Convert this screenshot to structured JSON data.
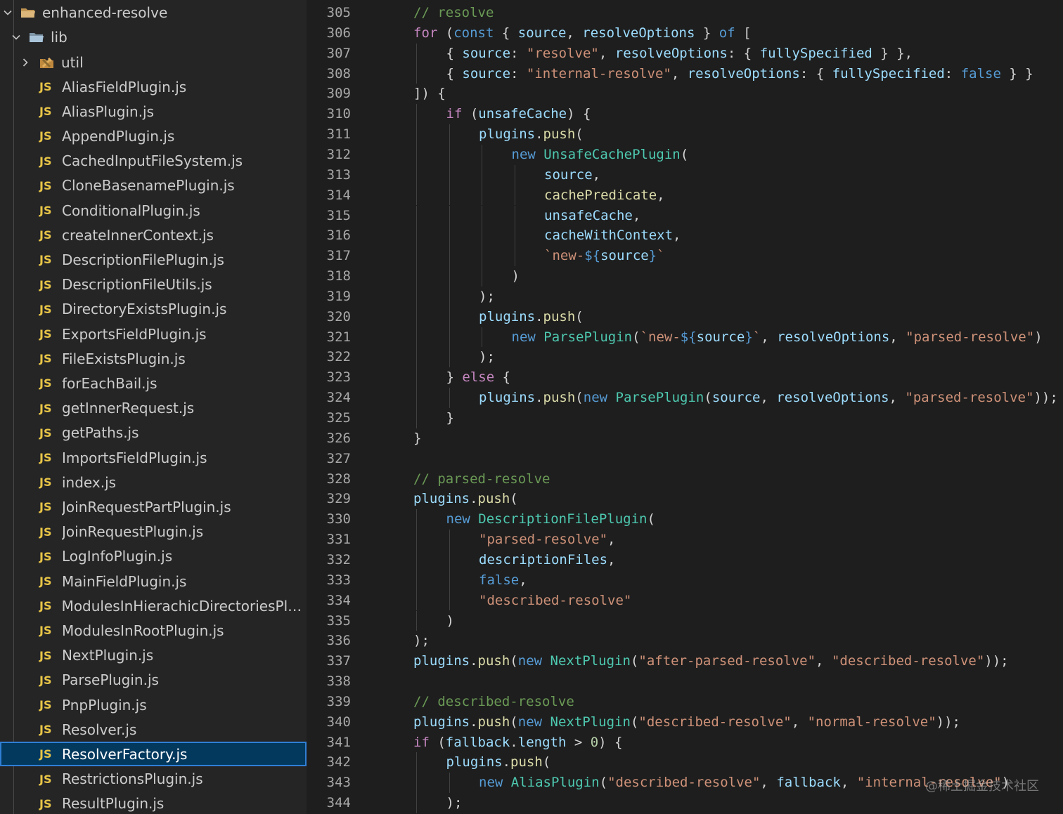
{
  "explorer": {
    "root": {
      "label": "enhanced-resolve",
      "icon": "folder-open-icon"
    },
    "lib": {
      "label": "lib",
      "icon": "folder-open-icon"
    },
    "util": {
      "label": "util",
      "icon": "tools-folder-icon"
    },
    "files": [
      "AliasFieldPlugin.js",
      "AliasPlugin.js",
      "AppendPlugin.js",
      "CachedInputFileSystem.js",
      "CloneBasenamePlugin.js",
      "ConditionalPlugin.js",
      "createInnerContext.js",
      "DescriptionFilePlugin.js",
      "DescriptionFileUtils.js",
      "DirectoryExistsPlugin.js",
      "ExportsFieldPlugin.js",
      "FileExistsPlugin.js",
      "forEachBail.js",
      "getInnerRequest.js",
      "getPaths.js",
      "ImportsFieldPlugin.js",
      "index.js",
      "JoinRequestPartPlugin.js",
      "JoinRequestPlugin.js",
      "LogInfoPlugin.js",
      "MainFieldPlugin.js",
      "ModulesInHierachicDirectoriesPlu...",
      "ModulesInRootPlugin.js",
      "NextPlugin.js",
      "ParsePlugin.js",
      "PnpPlugin.js",
      "Resolver.js",
      "ResolverFactory.js",
      "RestrictionsPlugin.js",
      "ResultPlugin.js"
    ],
    "file_icon_label": "JS",
    "selected_file": "ResolverFactory.js"
  },
  "editor": {
    "lines": [
      {
        "n": "305",
        "i": 0,
        "t": [
          [
            "cm",
            "// resolve"
          ]
        ]
      },
      {
        "n": "306",
        "i": 0,
        "t": [
          [
            "kwc",
            "for"
          ],
          [
            "pun",
            " ("
          ],
          [
            "kw",
            "const"
          ],
          [
            "pun",
            " { "
          ],
          [
            "var",
            "source"
          ],
          [
            "pun",
            ", "
          ],
          [
            "var",
            "resolveOptions"
          ],
          [
            "pun",
            " } "
          ],
          [
            "kw",
            "of"
          ],
          [
            "pun",
            " ["
          ]
        ]
      },
      {
        "n": "307",
        "i": 1,
        "t": [
          [
            "pun",
            "{ "
          ],
          [
            "var",
            "source"
          ],
          [
            "pun",
            ": "
          ],
          [
            "str",
            "\"resolve\""
          ],
          [
            "pun",
            ", "
          ],
          [
            "var",
            "resolveOptions"
          ],
          [
            "pun",
            ": { "
          ],
          [
            "var",
            "fullySpecified"
          ],
          [
            "pun",
            " } },"
          ]
        ]
      },
      {
        "n": "308",
        "i": 1,
        "t": [
          [
            "pun",
            "{ "
          ],
          [
            "var",
            "source"
          ],
          [
            "pun",
            ": "
          ],
          [
            "str",
            "\"internal-resolve\""
          ],
          [
            "pun",
            ", "
          ],
          [
            "var",
            "resolveOptions"
          ],
          [
            "pun",
            ": { "
          ],
          [
            "var",
            "fullySpecified"
          ],
          [
            "pun",
            ": "
          ],
          [
            "kw",
            "false"
          ],
          [
            "pun",
            " } }"
          ]
        ]
      },
      {
        "n": "309",
        "i": 0,
        "t": [
          [
            "pun",
            "]) {"
          ]
        ]
      },
      {
        "n": "310",
        "i": 1,
        "t": [
          [
            "kwc",
            "if"
          ],
          [
            "pun",
            " ("
          ],
          [
            "var",
            "unsafeCache"
          ],
          [
            "pun",
            ") {"
          ]
        ]
      },
      {
        "n": "311",
        "i": 2,
        "t": [
          [
            "var",
            "plugins"
          ],
          [
            "pun",
            "."
          ],
          [
            "fn",
            "push"
          ],
          [
            "pun",
            "("
          ]
        ]
      },
      {
        "n": "312",
        "i": 3,
        "t": [
          [
            "kw",
            "new"
          ],
          [
            "pun",
            " "
          ],
          [
            "cls",
            "UnsafeCachePlugin"
          ],
          [
            "pun",
            "("
          ]
        ]
      },
      {
        "n": "313",
        "i": 4,
        "t": [
          [
            "var",
            "source"
          ],
          [
            "pun",
            ","
          ]
        ]
      },
      {
        "n": "314",
        "i": 4,
        "t": [
          [
            "fn",
            "cachePredicate"
          ],
          [
            "pun",
            ","
          ]
        ]
      },
      {
        "n": "315",
        "i": 4,
        "t": [
          [
            "var",
            "unsafeCache"
          ],
          [
            "pun",
            ","
          ]
        ]
      },
      {
        "n": "316",
        "i": 4,
        "t": [
          [
            "var",
            "cacheWithContext"
          ],
          [
            "pun",
            ","
          ]
        ]
      },
      {
        "n": "317",
        "i": 4,
        "t": [
          [
            "str",
            "`new-"
          ],
          [
            "tpl",
            "${"
          ],
          [
            "var",
            "source"
          ],
          [
            "tpl",
            "}"
          ],
          [
            "str",
            "`"
          ]
        ]
      },
      {
        "n": "318",
        "i": 3,
        "t": [
          [
            "pun",
            ")"
          ]
        ]
      },
      {
        "n": "319",
        "i": 2,
        "t": [
          [
            "pun",
            ");"
          ]
        ]
      },
      {
        "n": "320",
        "i": 2,
        "t": [
          [
            "var",
            "plugins"
          ],
          [
            "pun",
            "."
          ],
          [
            "fn",
            "push"
          ],
          [
            "pun",
            "("
          ]
        ]
      },
      {
        "n": "321",
        "i": 3,
        "t": [
          [
            "kw",
            "new"
          ],
          [
            "pun",
            " "
          ],
          [
            "cls",
            "ParsePlugin"
          ],
          [
            "pun",
            "("
          ],
          [
            "str",
            "`new-"
          ],
          [
            "tpl",
            "${"
          ],
          [
            "var",
            "source"
          ],
          [
            "tpl",
            "}"
          ],
          [
            "str",
            "`"
          ],
          [
            "pun",
            ", "
          ],
          [
            "var",
            "resolveOptions"
          ],
          [
            "pun",
            ", "
          ],
          [
            "str",
            "\"parsed-resolve\""
          ],
          [
            "pun",
            ")"
          ]
        ]
      },
      {
        "n": "322",
        "i": 2,
        "t": [
          [
            "pun",
            ");"
          ]
        ]
      },
      {
        "n": "323",
        "i": 1,
        "t": [
          [
            "pun",
            "} "
          ],
          [
            "kwc",
            "else"
          ],
          [
            "pun",
            " {"
          ]
        ]
      },
      {
        "n": "324",
        "i": 2,
        "t": [
          [
            "var",
            "plugins"
          ],
          [
            "pun",
            "."
          ],
          [
            "fn",
            "push"
          ],
          [
            "pun",
            "("
          ],
          [
            "kw",
            "new"
          ],
          [
            "pun",
            " "
          ],
          [
            "cls",
            "ParsePlugin"
          ],
          [
            "pun",
            "("
          ],
          [
            "var",
            "source"
          ],
          [
            "pun",
            ", "
          ],
          [
            "var",
            "resolveOptions"
          ],
          [
            "pun",
            ", "
          ],
          [
            "str",
            "\"parsed-resolve\""
          ],
          [
            "pun",
            "));"
          ]
        ]
      },
      {
        "n": "325",
        "i": 1,
        "t": [
          [
            "pun",
            "}"
          ]
        ]
      },
      {
        "n": "326",
        "i": 0,
        "t": [
          [
            "pun",
            "}"
          ]
        ]
      },
      {
        "n": "327",
        "i": 0,
        "t": []
      },
      {
        "n": "328",
        "i": 0,
        "t": [
          [
            "cm",
            "// parsed-resolve"
          ]
        ]
      },
      {
        "n": "329",
        "i": 0,
        "t": [
          [
            "var",
            "plugins"
          ],
          [
            "pun",
            "."
          ],
          [
            "fn",
            "push"
          ],
          [
            "pun",
            "("
          ]
        ]
      },
      {
        "n": "330",
        "i": 1,
        "t": [
          [
            "kw",
            "new"
          ],
          [
            "pun",
            " "
          ],
          [
            "cls",
            "DescriptionFilePlugin"
          ],
          [
            "pun",
            "("
          ]
        ]
      },
      {
        "n": "331",
        "i": 2,
        "t": [
          [
            "str",
            "\"parsed-resolve\""
          ],
          [
            "pun",
            ","
          ]
        ]
      },
      {
        "n": "332",
        "i": 2,
        "t": [
          [
            "var",
            "descriptionFiles"
          ],
          [
            "pun",
            ","
          ]
        ]
      },
      {
        "n": "333",
        "i": 2,
        "t": [
          [
            "kw",
            "false"
          ],
          [
            "pun",
            ","
          ]
        ]
      },
      {
        "n": "334",
        "i": 2,
        "t": [
          [
            "str",
            "\"described-resolve\""
          ]
        ]
      },
      {
        "n": "335",
        "i": 1,
        "t": [
          [
            "pun",
            ")"
          ]
        ]
      },
      {
        "n": "336",
        "i": 0,
        "t": [
          [
            "pun",
            ");"
          ]
        ]
      },
      {
        "n": "337",
        "i": 0,
        "t": [
          [
            "var",
            "plugins"
          ],
          [
            "pun",
            "."
          ],
          [
            "fn",
            "push"
          ],
          [
            "pun",
            "("
          ],
          [
            "kw",
            "new"
          ],
          [
            "pun",
            " "
          ],
          [
            "cls",
            "NextPlugin"
          ],
          [
            "pun",
            "("
          ],
          [
            "str",
            "\"after-parsed-resolve\""
          ],
          [
            "pun",
            ", "
          ],
          [
            "str",
            "\"described-resolve\""
          ],
          [
            "pun",
            "));"
          ]
        ]
      },
      {
        "n": "338",
        "i": 0,
        "t": []
      },
      {
        "n": "339",
        "i": 0,
        "t": [
          [
            "cm",
            "// described-resolve"
          ]
        ]
      },
      {
        "n": "340",
        "i": 0,
        "t": [
          [
            "var",
            "plugins"
          ],
          [
            "pun",
            "."
          ],
          [
            "fn",
            "push"
          ],
          [
            "pun",
            "("
          ],
          [
            "kw",
            "new"
          ],
          [
            "pun",
            " "
          ],
          [
            "cls",
            "NextPlugin"
          ],
          [
            "pun",
            "("
          ],
          [
            "str",
            "\"described-resolve\""
          ],
          [
            "pun",
            ", "
          ],
          [
            "str",
            "\"normal-resolve\""
          ],
          [
            "pun",
            "));"
          ]
        ]
      },
      {
        "n": "341",
        "i": 0,
        "t": [
          [
            "kwc",
            "if"
          ],
          [
            "pun",
            " ("
          ],
          [
            "var",
            "fallback"
          ],
          [
            "pun",
            "."
          ],
          [
            "var",
            "length"
          ],
          [
            "pun",
            " > "
          ],
          [
            "num",
            "0"
          ],
          [
            "pun",
            ") {"
          ]
        ]
      },
      {
        "n": "342",
        "i": 1,
        "t": [
          [
            "var",
            "plugins"
          ],
          [
            "pun",
            "."
          ],
          [
            "fn",
            "push"
          ],
          [
            "pun",
            "("
          ]
        ]
      },
      {
        "n": "343",
        "i": 2,
        "t": [
          [
            "kw",
            "new"
          ],
          [
            "pun",
            " "
          ],
          [
            "cls",
            "AliasPlugin"
          ],
          [
            "pun",
            "("
          ],
          [
            "str",
            "\"described-resolve\""
          ],
          [
            "pun",
            ", "
          ],
          [
            "var",
            "fallback"
          ],
          [
            "pun",
            ", "
          ],
          [
            "str",
            "\"internal-resolve\""
          ],
          [
            "pun",
            ")"
          ]
        ]
      },
      {
        "n": "344",
        "i": 1,
        "t": [
          [
            "pun",
            ");"
          ]
        ]
      }
    ]
  },
  "watermark": "@稀土掘金技术社区",
  "colors": {
    "sidebar_bg": "#252526",
    "editor_bg": "#1e1e1e",
    "selection_bg": "#04395e",
    "selection_border": "#2f7fd6",
    "js_icon": "#e8c547"
  }
}
